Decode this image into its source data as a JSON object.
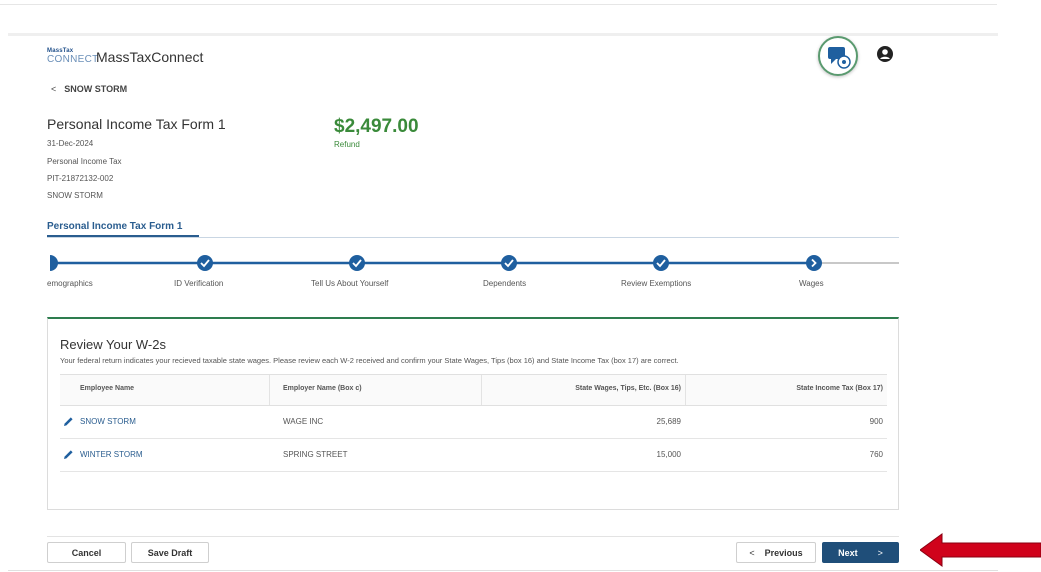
{
  "app": {
    "logo_top": "MassTax",
    "logo_bottom": "CONNECT",
    "title": "MassTaxConnect"
  },
  "icons": {
    "chat": "chat-support-icon",
    "user": "user-account-icon",
    "back": "chevron-left-icon",
    "edit": "pencil-icon",
    "next": "chevron-right-icon",
    "previous": "chevron-left-icon"
  },
  "nav": {
    "back_label": "SNOW STORM"
  },
  "form": {
    "title": "Personal Income Tax Form 1",
    "date": "31-Dec-2024",
    "tax_type": "Personal Income Tax",
    "account_id": "PIT-21872132-002",
    "taxpayer": "SNOW STORM",
    "amount": "$2,497.00",
    "amount_label": "Refund",
    "tab_label": "Personal Income Tax Form 1"
  },
  "stepper": {
    "steps": [
      {
        "label": "emographics",
        "status": "partial"
      },
      {
        "label": "ID Verification",
        "status": "complete"
      },
      {
        "label": "Tell Us About Yourself",
        "status": "complete"
      },
      {
        "label": "Dependents",
        "status": "complete"
      },
      {
        "label": "Review Exemptions",
        "status": "complete"
      },
      {
        "label": "Wages",
        "status": "current"
      }
    ]
  },
  "w2": {
    "title": "Review Your W-2s",
    "description": "Your federal return indicates your recieved taxable state wages. Please review each W-2 received and confirm your State Wages, Tips (box 16) and State Income Tax (box 17) are correct.",
    "columns": [
      "Employee Name",
      "Employer Name (Box c)",
      "State Wages, Tips, Etc. (Box 16)",
      "State Income Tax (Box 17)"
    ],
    "rows": [
      {
        "employee": "SNOW STORM",
        "employer": "WAGE INC",
        "wages": "25,689",
        "tax": "900"
      },
      {
        "employee": "WINTER STORM",
        "employer": "SPRING STREET",
        "wages": "15,000",
        "tax": "760"
      }
    ]
  },
  "footer": {
    "cancel": "Cancel",
    "save_draft": "Save Draft",
    "previous": "Previous",
    "next": "Next"
  },
  "colors": {
    "primary": "#1f4e79",
    "step_blue": "#1f5f9f",
    "refund_green": "#3a8a3a",
    "annotation_red": "#d0021b"
  }
}
